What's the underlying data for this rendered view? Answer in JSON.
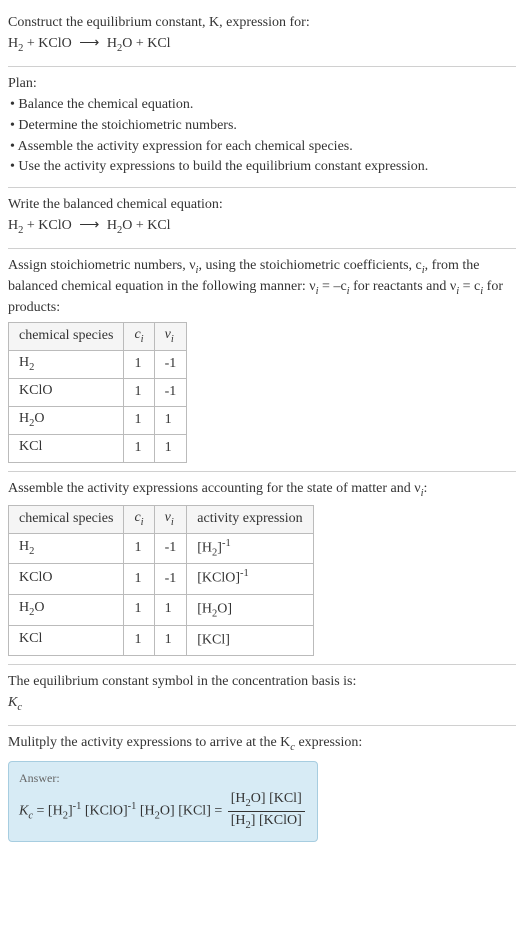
{
  "intro": {
    "line1": "Construct the equilibrium constant, K, expression for:",
    "equation_lhs1": "H",
    "equation_lhs1_sub": "2",
    "plus": " + ",
    "equation_lhs2": "KClO",
    "arrow": "⟶",
    "equation_rhs1": "H",
    "equation_rhs1_sub": "2",
    "equation_rhs1_tail": "O",
    "equation_rhs2": "KCl"
  },
  "plan": {
    "title": "Plan:",
    "b1": "• Balance the chemical equation.",
    "b2": "• Determine the stoichiometric numbers.",
    "b3": "• Assemble the activity expression for each chemical species.",
    "b4": "• Use the activity expressions to build the equilibrium constant expression."
  },
  "balanced": {
    "title": "Write the balanced chemical equation:"
  },
  "assign": {
    "text1": "Assign stoichiometric numbers, ν",
    "text1_sub": "i",
    "text2": ", using the stoichiometric coefficients, c",
    "text2_sub": "i",
    "text3": ", from the balanced chemical equation in the following manner: ν",
    "text3_sub": "i",
    "text4": " = –c",
    "text4_sub": "i",
    "text5": " for reactants and ν",
    "text5_sub": "i",
    "text6": " = c",
    "text6_sub": "i",
    "text7": " for products:",
    "head_species": "chemical species",
    "head_c": "c",
    "head_c_sub": "i",
    "head_v": "ν",
    "head_v_sub": "i",
    "rows": [
      {
        "sp": "H",
        "sp_sub": "2",
        "sp_tail": "",
        "c": "1",
        "v": "-1"
      },
      {
        "sp": "KClO",
        "sp_sub": "",
        "sp_tail": "",
        "c": "1",
        "v": "-1"
      },
      {
        "sp": "H",
        "sp_sub": "2",
        "sp_tail": "O",
        "c": "1",
        "v": "1"
      },
      {
        "sp": "KCl",
        "sp_sub": "",
        "sp_tail": "",
        "c": "1",
        "v": "1"
      }
    ]
  },
  "activity": {
    "title1": "Assemble the activity expressions accounting for the state of matter and ν",
    "title1_sub": "i",
    "title1_tail": ":",
    "head_species": "chemical species",
    "head_c": "c",
    "head_c_sub": "i",
    "head_v": "ν",
    "head_v_sub": "i",
    "head_act": "activity expression",
    "rows": [
      {
        "sp": "H",
        "sp_sub": "2",
        "sp_tail": "",
        "c": "1",
        "v": "-1",
        "act_pre": "[H",
        "act_sub": "2",
        "act_mid": "]",
        "act_sup": "-1",
        "act_tail": ""
      },
      {
        "sp": "KClO",
        "sp_sub": "",
        "sp_tail": "",
        "c": "1",
        "v": "-1",
        "act_pre": "[KClO]",
        "act_sub": "",
        "act_mid": "",
        "act_sup": "-1",
        "act_tail": ""
      },
      {
        "sp": "H",
        "sp_sub": "2",
        "sp_tail": "O",
        "c": "1",
        "v": "1",
        "act_pre": "[H",
        "act_sub": "2",
        "act_mid": "O]",
        "act_sup": "",
        "act_tail": ""
      },
      {
        "sp": "KCl",
        "sp_sub": "",
        "sp_tail": "",
        "c": "1",
        "v": "1",
        "act_pre": "[KCl]",
        "act_sub": "",
        "act_mid": "",
        "act_sup": "",
        "act_tail": ""
      }
    ]
  },
  "symbol": {
    "line1": "The equilibrium constant symbol in the concentration basis is:",
    "sym": "K",
    "sym_sub": "c"
  },
  "final": {
    "title": "Mulitply the activity expressions to arrive at the K",
    "title_sub": "c",
    "title_tail": " expression:",
    "answer_label": "Answer:",
    "Kc": "K",
    "Kc_sub": "c",
    "eq": " = [H",
    "eq_sub1": "2",
    "eq2": "]",
    "eq_sup1": "-1",
    "eq3": " [KClO]",
    "eq_sup2": "-1",
    "eq4": " [H",
    "eq_sub2": "2",
    "eq5": "O] [KCl] = ",
    "num": "[H",
    "num_sub": "2",
    "num2": "O] [KCl]",
    "den": "[H",
    "den_sub": "2",
    "den2": "] [KClO]"
  }
}
